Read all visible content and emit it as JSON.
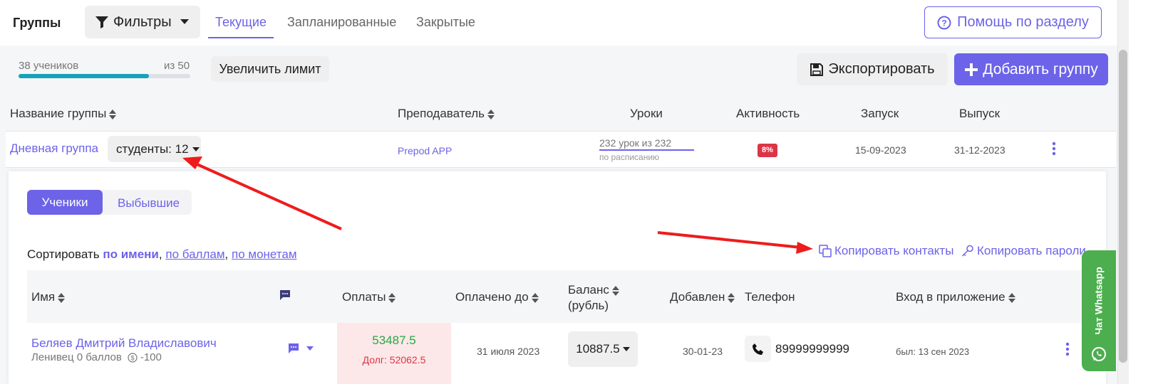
{
  "header": {
    "title": "Группы",
    "filters_label": "Фильтры",
    "tabs": [
      "Текущие",
      "Запланированные",
      "Закрытые"
    ],
    "help_label": "Помощь по разделу"
  },
  "limit": {
    "students_label": "38 учеников",
    "of_label": "из 50",
    "progress": 0.76,
    "increase_label": "Увеличить лимит"
  },
  "actions": {
    "export_label": "Экспортировать",
    "add_group_label": "Добавить группу"
  },
  "groups_table": {
    "headers": {
      "name": "Название группы",
      "teacher": "Преподаватель",
      "lessons": "Уроки",
      "activity": "Активность",
      "start": "Запуск",
      "end": "Выпуск"
    },
    "row": {
      "name": "Дневная группа",
      "students_label": "студенты: 12",
      "teacher": "Prepod APP",
      "lessons": "232 урок из 232",
      "lessons_sub": "по расписанию",
      "activity": "8%",
      "start": "15-09-2023",
      "end": "31-12-2023"
    }
  },
  "panel": {
    "tabs": [
      "Ученики",
      "Выбывшие"
    ],
    "sort_prefix": "Сортировать",
    "sort_options": [
      "по имени",
      "по баллам",
      "по монетам"
    ],
    "copy_contacts": "Копировать контакты",
    "copy_passwords": "Копировать пароли"
  },
  "students_table": {
    "headers": {
      "name": "Имя",
      "payments": "Оплаты",
      "paid_until": "Оплачено до",
      "balance_line1": "Баланс",
      "balance_line2": "(рубль)",
      "added": "Добавлен",
      "phone": "Телефон",
      "app_login": "Вход в приложение"
    },
    "row": {
      "name": "Беляев Дмитрий Владиславович",
      "sub_label": "Ленивец 0 баллов",
      "coins": "-100",
      "payment": "53487.5",
      "debt": "Долг: 52062.5",
      "paid_until": "31 июля 2023",
      "balance": "10887.5",
      "added": "30-01-23",
      "phone": "89999999999",
      "last_login": "был: 13 сен 2023"
    }
  },
  "whatsapp": {
    "label": "Чат Whatsapp"
  },
  "colors": {
    "accent": "#6c63e8",
    "progress": "#17a2b8",
    "danger": "#dc3545",
    "success": "#28a745",
    "arrow": "#ee1c1c",
    "whatsapp": "#4cae4f"
  }
}
